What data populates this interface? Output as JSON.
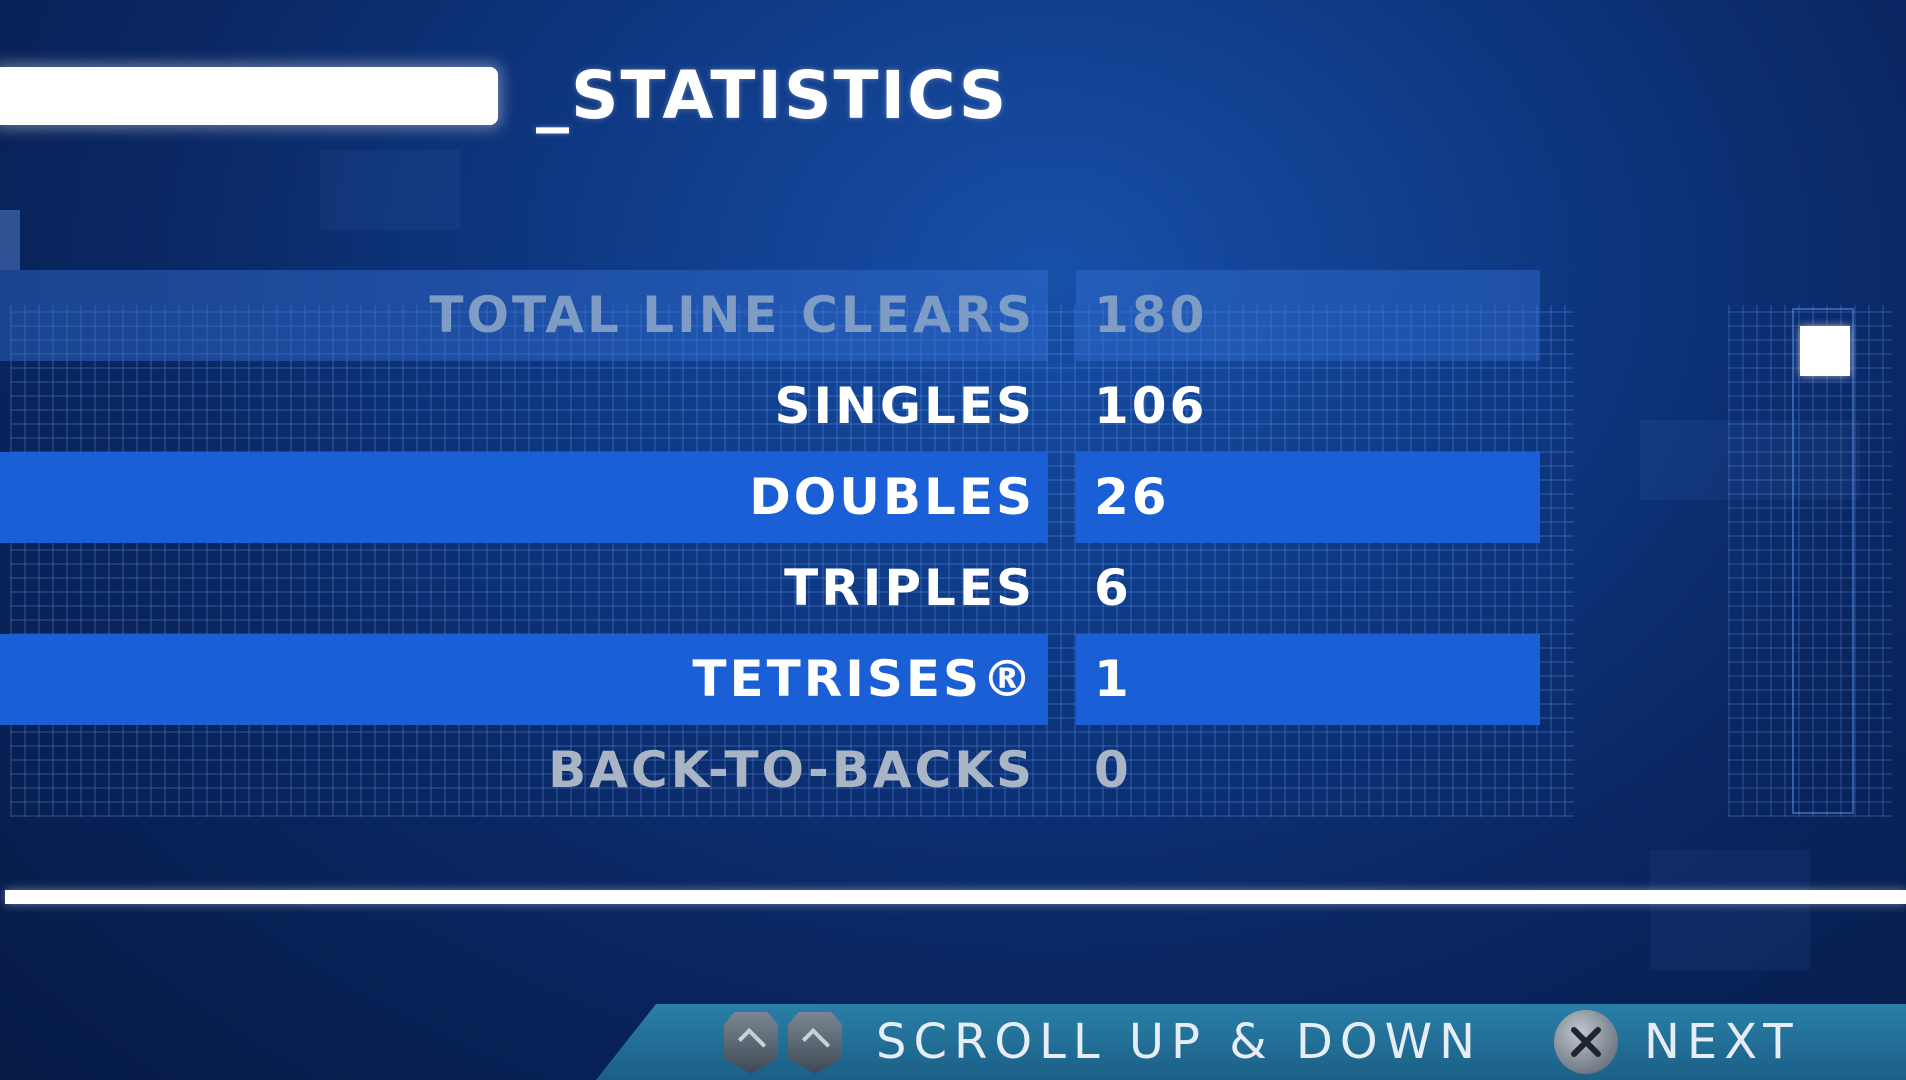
{
  "screen": {
    "title": "_STATISTICS"
  },
  "stats": [
    {
      "label": "TOTAL LINE CLEARS",
      "value": "180",
      "style": "dim"
    },
    {
      "label": "SINGLES",
      "value": "106",
      "style": "plain"
    },
    {
      "label": "DOUBLES",
      "value": "26",
      "style": "hl"
    },
    {
      "label": "TRIPLES",
      "value": "6",
      "style": "plain"
    },
    {
      "label": "TETRISES®",
      "value": "1",
      "style": "hl"
    },
    {
      "label": "BACK-TO-BACKS",
      "value": "0",
      "style": "grey"
    }
  ],
  "scroll": {
    "position": 0.0
  },
  "footer": {
    "scroll_hint": "SCROLL UP & DOWN",
    "next_label": "NEXT",
    "scroll_icons": [
      "left-shoulder-button-icon",
      "right-shoulder-button-icon"
    ],
    "next_icon": "cross-button-icon"
  },
  "colors": {
    "highlight_row": "#1a5fd6",
    "background": "#0a2763",
    "footer_bar": "#2a7fa8"
  }
}
